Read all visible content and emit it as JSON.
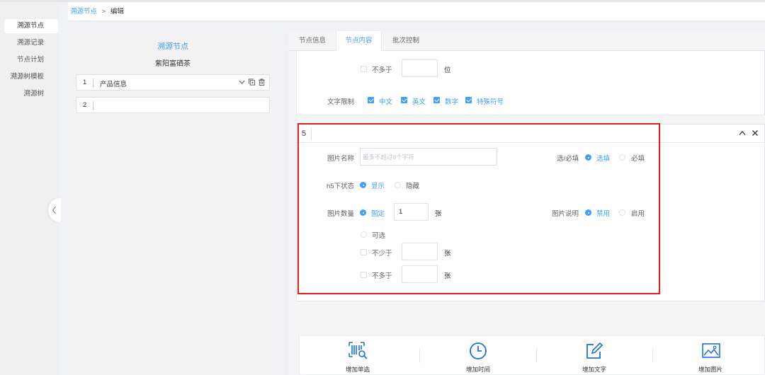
{
  "breadcrumb": {
    "link": "溯源节点",
    "separator": ">",
    "current": "编辑"
  },
  "sidebar": {
    "items": [
      {
        "label": "溯源节点"
      },
      {
        "label": "溯源记录"
      },
      {
        "label": "节点计划"
      },
      {
        "label": "溯源树模板"
      },
      {
        "label": "溯源树"
      }
    ]
  },
  "left_panel": {
    "title": "溯源节点",
    "subtitle": "紫阳富硒茶",
    "nodes": [
      {
        "index": "1",
        "label": "产品信息"
      },
      {
        "index": "2",
        "label": ""
      }
    ]
  },
  "tabs": [
    {
      "label": "节点信息"
    },
    {
      "label": "节点内容"
    },
    {
      "label": "批次控制"
    }
  ],
  "text_section": {
    "max_label": "不多于",
    "max_value": "",
    "max_unit": "位",
    "limit_label": "文字限制",
    "limit_options": [
      {
        "label": "中文",
        "checked": true
      },
      {
        "label": "英文",
        "checked": true
      },
      {
        "label": "数字",
        "checked": true
      },
      {
        "label": "特殊符号",
        "checked": true
      }
    ]
  },
  "image_section": {
    "index": "5",
    "name_label": "图片名称",
    "name_placeholder": "最多不超过8个字符",
    "required_label": "选/必填",
    "required_options": [
      {
        "label": "选填",
        "selected": true
      },
      {
        "label": "必填",
        "selected": false
      }
    ],
    "h5_label": "h5下状态",
    "h5_options": [
      {
        "label": "显示",
        "selected": true
      },
      {
        "label": "隐藏",
        "selected": false
      }
    ],
    "count_label": "图片数量",
    "fixed_label": "固定",
    "fixed_value": "1",
    "count_unit": "张",
    "optional_label": "可选",
    "min_label": "不少于",
    "min_value": "",
    "max_label": "不多于",
    "max_value": "",
    "desc_label": "图片说明",
    "desc_options": [
      {
        "label": "禁用",
        "selected": true
      },
      {
        "label": "启用",
        "selected": false
      }
    ]
  },
  "toolbar": {
    "buttons": [
      {
        "label": "增加单选",
        "icon": "barcode-search-icon"
      },
      {
        "label": "增加时间",
        "icon": "clock-icon"
      },
      {
        "label": "增加文字",
        "icon": "edit-icon"
      },
      {
        "label": "增加图片",
        "icon": "image-icon"
      }
    ]
  },
  "colors": {
    "accent": "#409eff",
    "highlight": "#e02020"
  }
}
